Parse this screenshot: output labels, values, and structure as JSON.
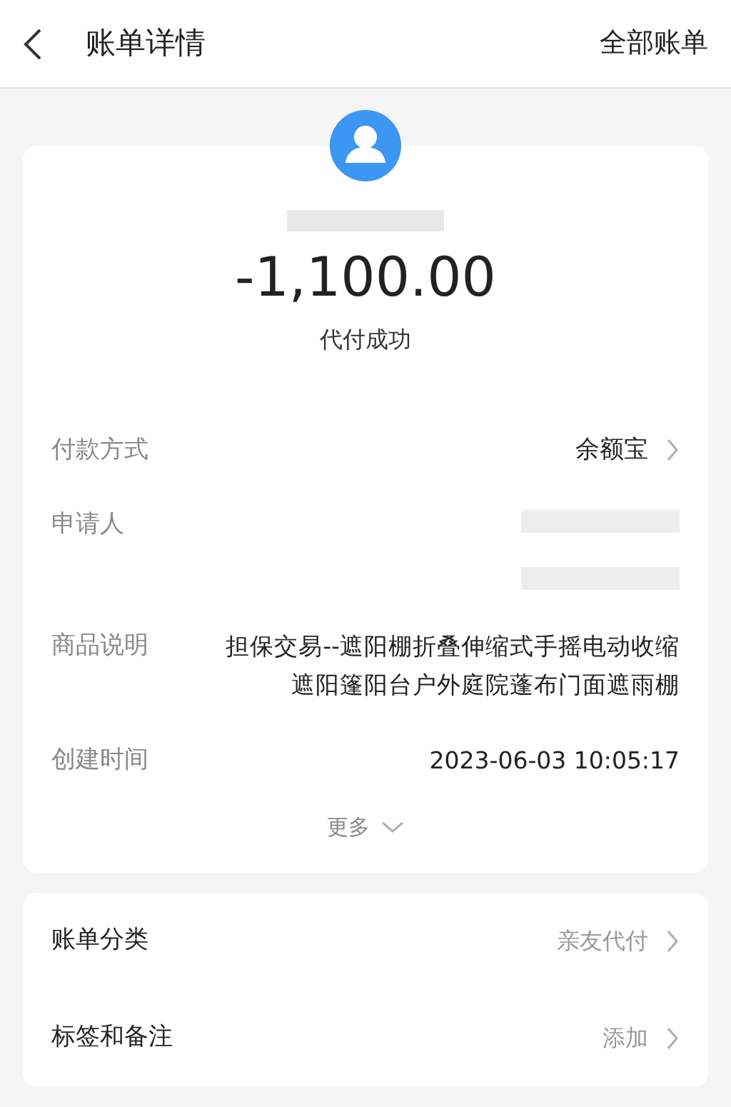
{
  "header": {
    "title": "账单详情",
    "action": "全部账单"
  },
  "summary": {
    "amount": "-1,100.00",
    "status": "代付成功"
  },
  "details": [
    {
      "kind": "link",
      "label": "付款方式",
      "value": "余额宝"
    },
    {
      "kind": "redacted",
      "label": "申请人"
    },
    {
      "kind": "text",
      "label": "商品说明",
      "value": "担保交易--遮阳棚折叠伸缩式手摇电动收缩遮阳篷阳台户外庭院蓬布门面遮雨棚"
    },
    {
      "kind": "text",
      "label": "创建时间",
      "value": "2023-06-03 10:05:17"
    }
  ],
  "more": "更多",
  "extras": [
    {
      "label": "账单分类",
      "value": "亲友代付"
    },
    {
      "label": "标签和备注",
      "value": "添加"
    }
  ]
}
